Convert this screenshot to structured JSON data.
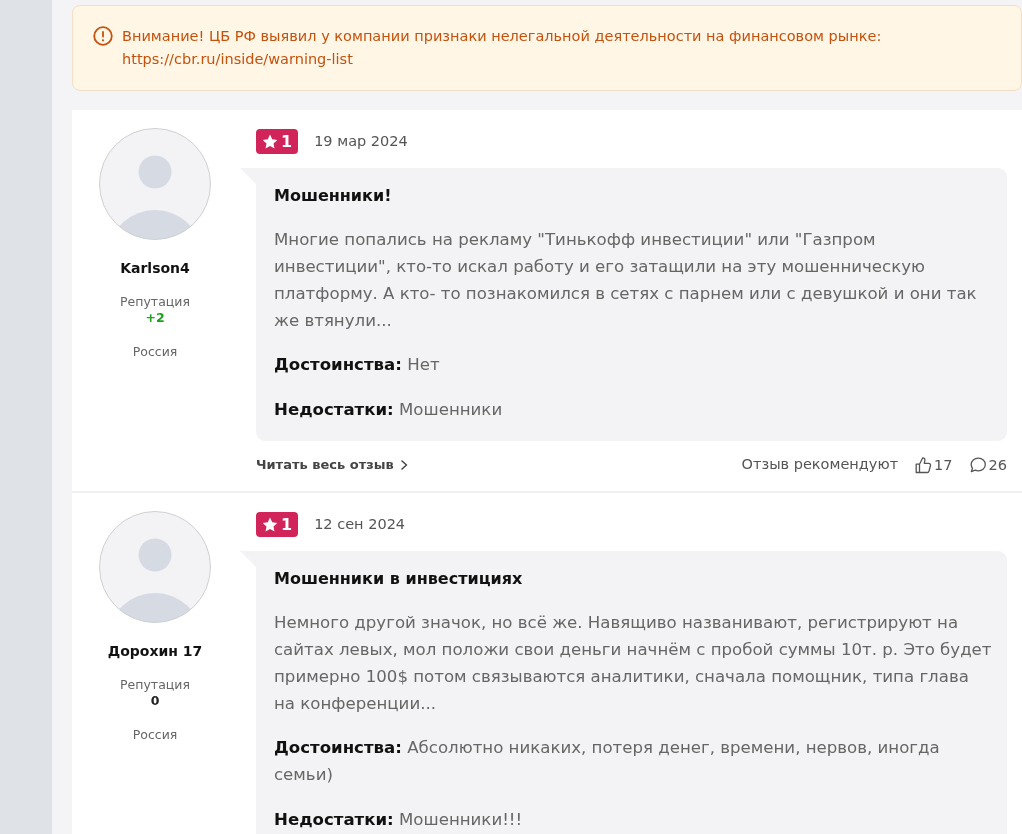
{
  "alert": {
    "message": "Внимание! ЦБ РФ выявил у компании признаки нелегальной деятельности на финансовом рынке:",
    "link": "https://cbr.ru/inside/warning-list"
  },
  "reviews": [
    {
      "author": {
        "name": "Karlson4",
        "reputation_label": "Репутация",
        "reputation": {
          "value": "+2",
          "color": "#1aa31a"
        },
        "country": "Россия"
      },
      "rating": "1",
      "date": "19 мар 2024",
      "title": "Мошенники!",
      "text": "Многие попались на рекламу \"Тинькофф инвестиции\" или \"Газпром инвестиции\", кто-то искал работу и его затащили на эту мошенническую платформу. А кто- то познакомился в сетях с парнем или с девушкой и они так же втянули...",
      "pros": "**Достоинства:** Нет",
      "cons": "**Недостатки:** Мошенники",
      "read_more": "Читать весь отзыв",
      "recommend_label": "Отзыв рекомендуют",
      "likes": "17",
      "comments": "26"
    },
    {
      "author": {
        "name": "Дорохин 17",
        "reputation_label": "Репутация",
        "reputation": {
          "value": "0",
          "color": "#222222"
        },
        "country": "Россия"
      },
      "rating": "1",
      "date": "12 сен 2024",
      "title": "Мошенники в инвестициях",
      "text": "Немного другой значок, но всё же. Навящиво названивают, регистрируют на сайтах левых, мол положи свои деньги начнём с пробой суммы 10т. р. Это будет примерно 100$ потом связываются аналитики, сначала помощник, типа глава на конференции...",
      "pros": "**Достоинства:** Абсолютно никаких, потеря денег, времени, нервов, иногда семьи)",
      "cons": "**Недостатки:** Мошенники!!!"
    }
  ]
}
